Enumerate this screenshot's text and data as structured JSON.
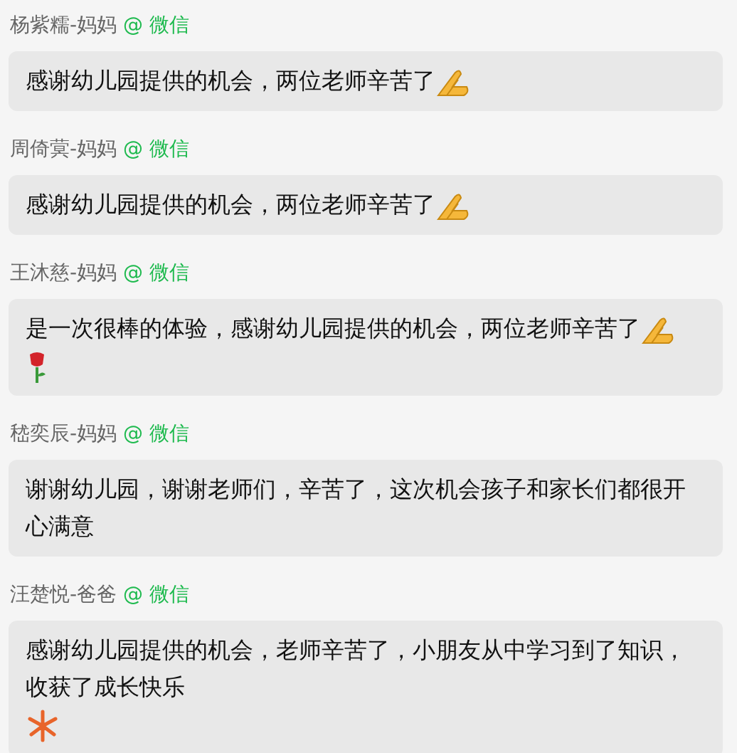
{
  "messages": [
    {
      "sender": "杨紫糯-妈妈",
      "source": "@ 微信",
      "text": "感谢幼儿园提供的机会，两位老师辛苦了",
      "stickers": [
        {
          "kind": "hands"
        }
      ]
    },
    {
      "sender": "周倚蓂-妈妈",
      "source": "@ 微信",
      "text": "感谢幼儿园提供的机会，两位老师辛苦了",
      "stickers": [
        {
          "kind": "hands"
        }
      ]
    },
    {
      "sender": "王沐慈-妈妈",
      "source": "@ 微信",
      "text": "是一次很棒的体验，感谢幼儿园提供的机会，两位老师辛苦了",
      "stickers": [
        {
          "kind": "hands"
        },
        {
          "kind": "rose"
        }
      ]
    },
    {
      "sender": "嵇奕辰-妈妈",
      "source": "@ 微信",
      "text": "谢谢幼儿园，谢谢老师们，辛苦了，这次机会孩子和家长们都很开心满意"
    },
    {
      "sender": "汪楚悦-爸爸",
      "source": "@ 微信",
      "text": "感谢幼儿园提供的机会，老师辛苦了，小朋友从中学习到了知识，收获了成长快乐",
      "footer_stickers": [
        {
          "kind": "fireworks"
        }
      ]
    }
  ]
}
